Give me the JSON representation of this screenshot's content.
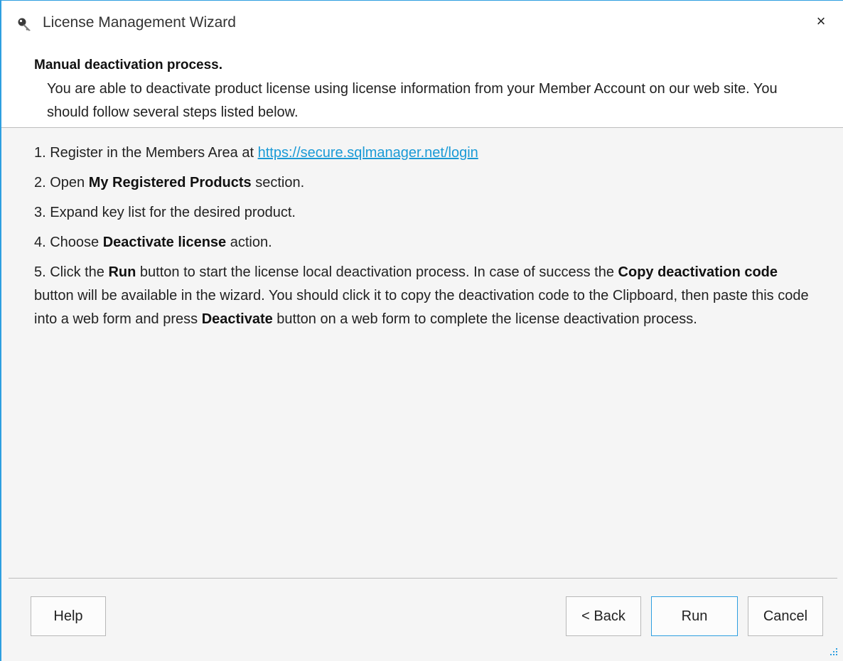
{
  "window": {
    "title": "License Management Wizard",
    "close_glyph": "×",
    "accent_color": "#2e9fe0"
  },
  "header": {
    "title": "Manual deactivation process.",
    "description": "You are able to deactivate product license using license information from your Member Account on our web site. You should follow several steps listed below."
  },
  "steps": {
    "s1": {
      "prefix": "1. Register in the Members Area at ",
      "link": "https://secure.sqlmanager.net/login"
    },
    "s2": {
      "prefix": "2. Open ",
      "bold": "My Registered Products",
      "suffix": " section."
    },
    "s3": {
      "text": "3. Expand key list for the desired product."
    },
    "s4": {
      "prefix": "4. Choose ",
      "bold": "Deactivate license",
      "suffix": " action."
    },
    "s5": {
      "p1": "5. Click the ",
      "b1": "Run",
      "p2": " button to start the license local deactivation process. In case of success the ",
      "b2": "Copy deactivation code",
      "p3": " button will be available in the wizard. You should click it to copy the deactivation code to the Clipboard, then paste this code into a web form and press ",
      "b3": "Deactivate",
      "p4": " button on a web form to complete the license deactivation process."
    }
  },
  "buttons": {
    "help": "Help",
    "back": "< Back",
    "run": "Run",
    "cancel": "Cancel"
  },
  "icons": {
    "title": "key-icon",
    "close": "close-icon",
    "resize": "resize-grip-icon"
  }
}
